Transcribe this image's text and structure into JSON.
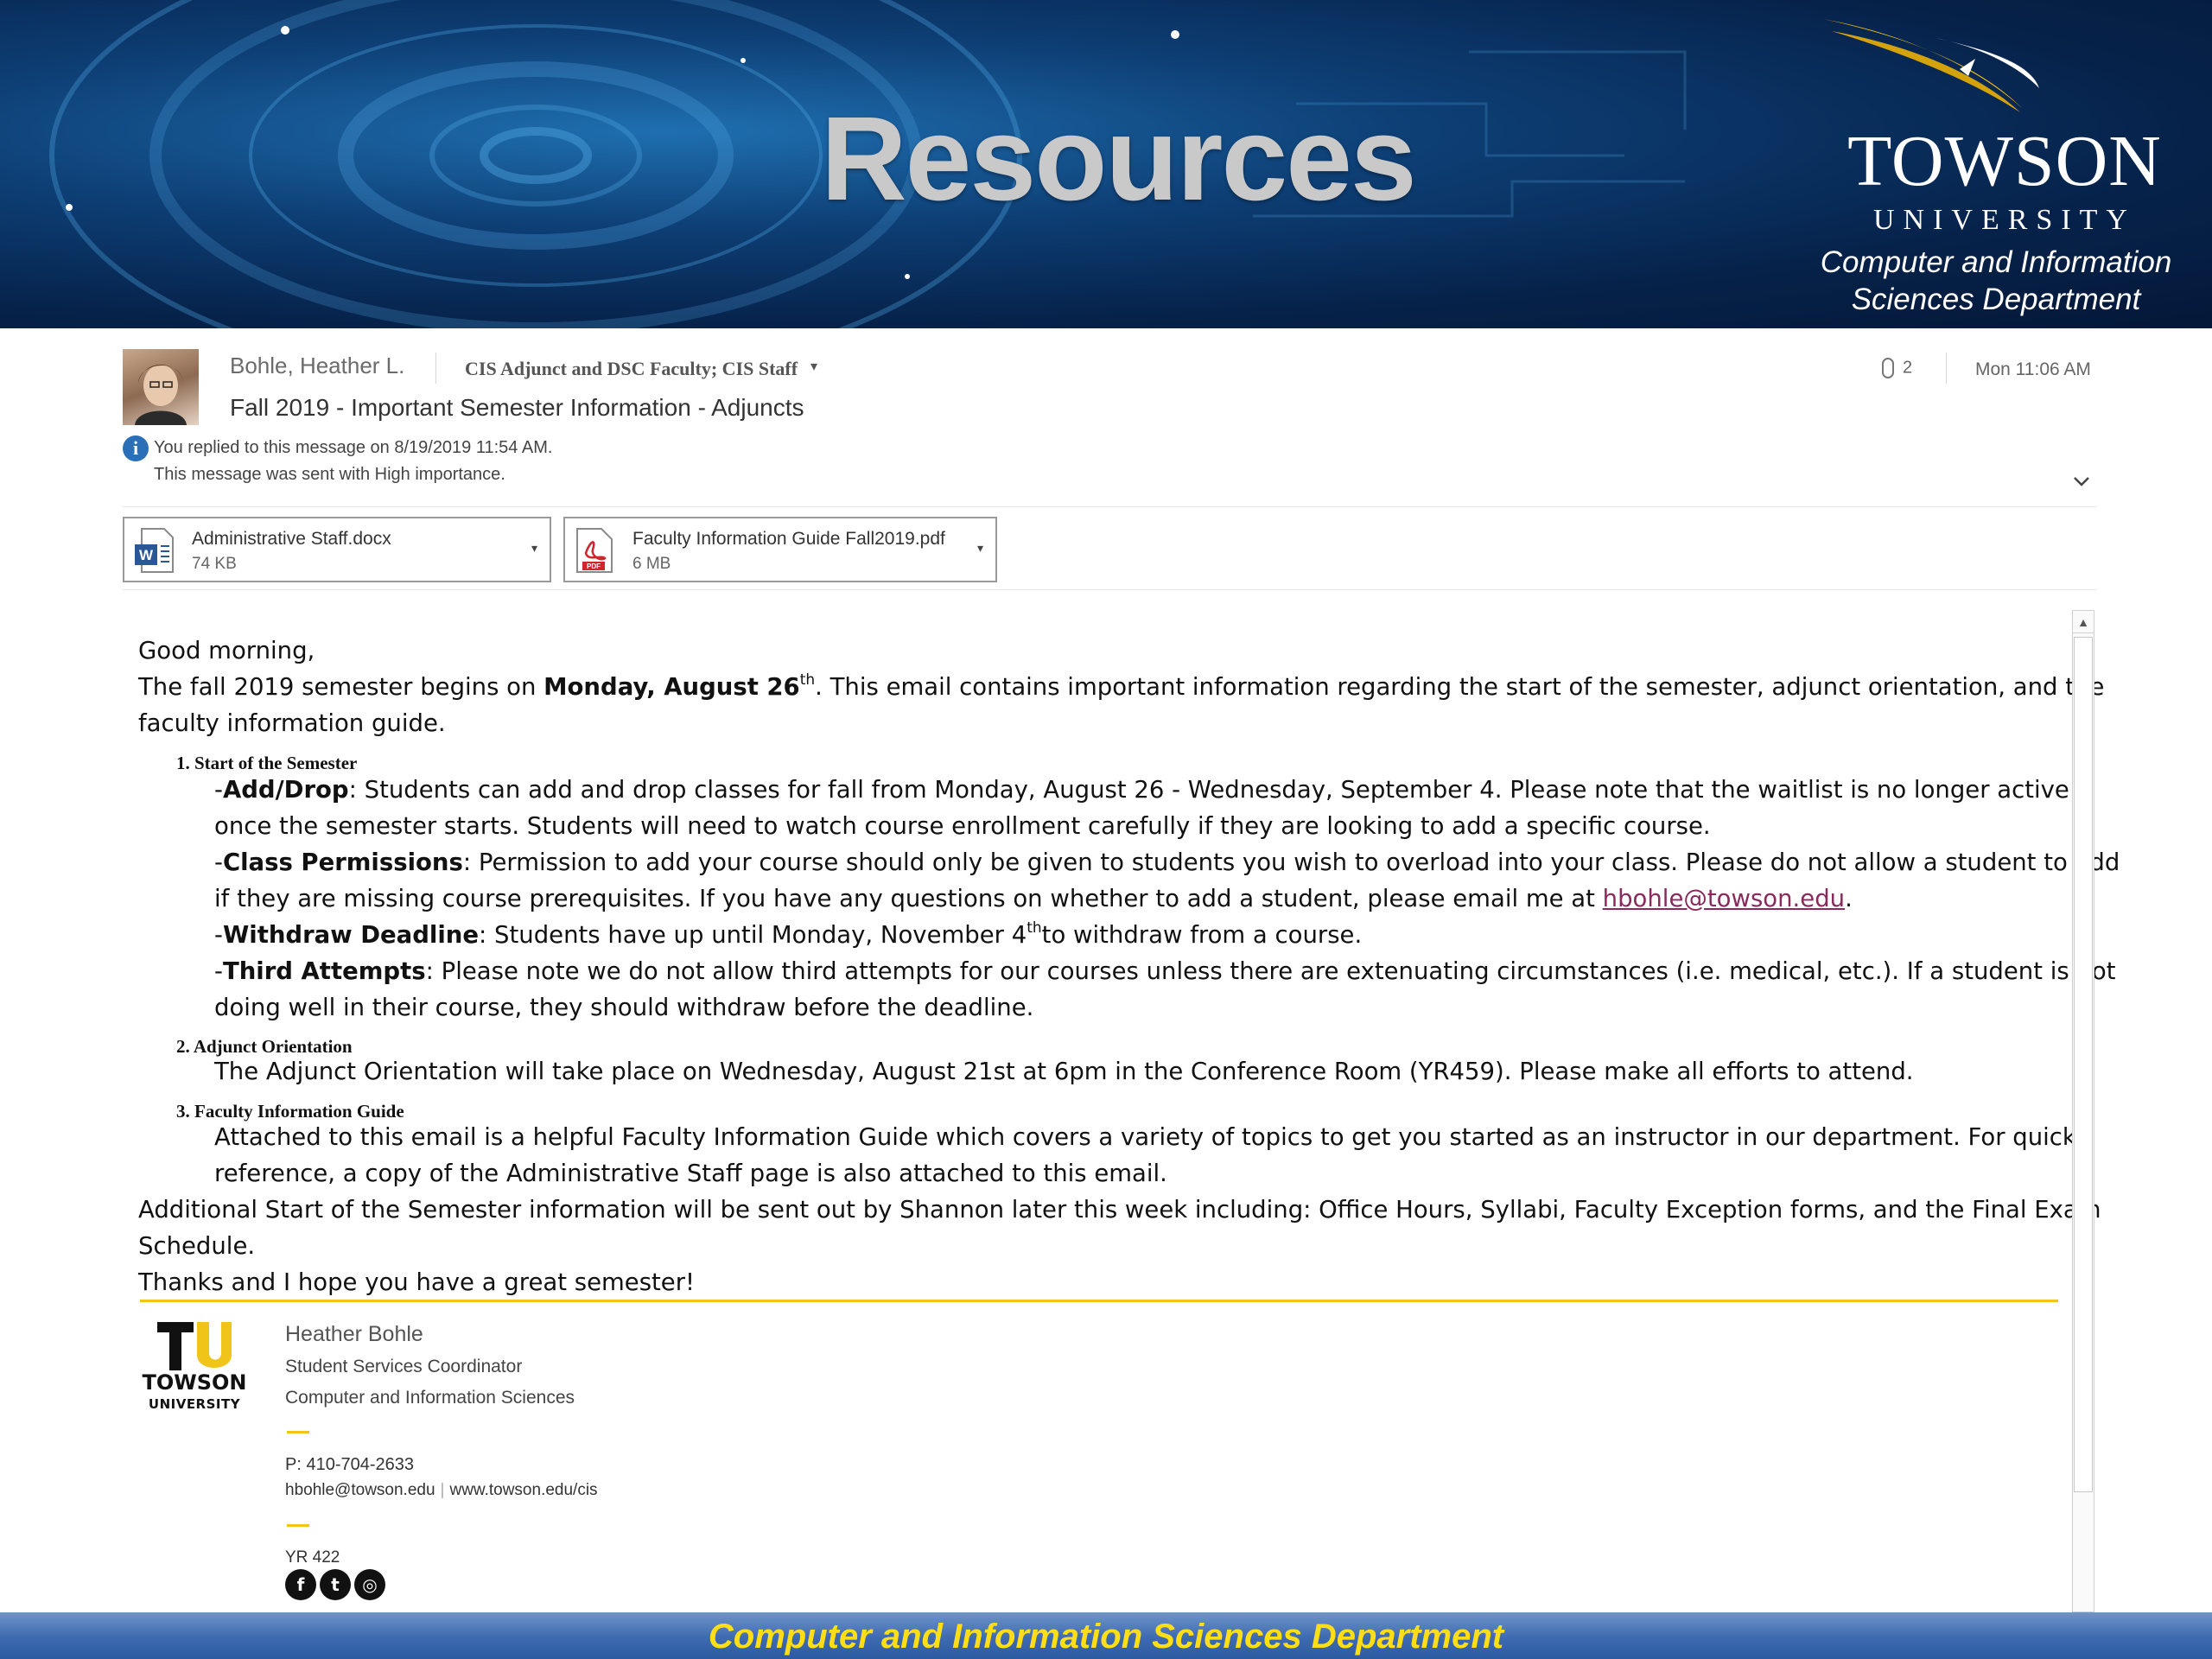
{
  "banner": {
    "title": "Resources",
    "logo_wordmark": "TOWSON",
    "logo_subtitle": "UNIVERSITY",
    "department": [
      "Computer and Information",
      "Sciences Department"
    ]
  },
  "email": {
    "sender": "Bohle, Heather L.",
    "recipients": "CIS Adjunct and DSC Faculty; CIS Staff",
    "attachment_count": "2",
    "timestamp": "Mon 11:06 AM",
    "subject": "Fall 2019 - Important Semester Information - Adjuncts",
    "info_lines": [
      "You replied to this message on 8/19/2019 11:54 AM.",
      "This message was sent with High importance."
    ],
    "attachments": [
      {
        "name": "Administrative Staff.docx",
        "size": "74 KB",
        "type_icon": "word-doc-icon"
      },
      {
        "name": "Faculty Information Guide Fall2019.pdf",
        "size": "6 MB",
        "type_icon": "pdf-icon"
      }
    ]
  },
  "body": {
    "greeting": "Good morning,",
    "intro": {
      "pre": "The fall 2019 semester begins on ",
      "bold": "Monday, August 26",
      "sup": "th",
      "post": ". This email contains important information regarding the start of the semester, adjunct orientation, and the",
      "line2": "faculty information guide."
    },
    "sections": [
      {
        "heading": "1. Start of the Semester",
        "items": [
          {
            "label": "Add/Drop",
            "lines": [
              ": Students can add and drop classes for fall from Monday, August 26 - Wednesday, September 4. Please note that the waitlist is no longer active",
              "once the semester starts. Students will need to watch course enrollment carefully if they are looking to add a specific course."
            ]
          },
          {
            "label": "Class Permissions",
            "lines": [
              ": Permission to add your course should only be given to students you wish to overload into your class. Please do not allow a student to add",
              "if they are missing course prerequisites. If you have any questions on whether to add a student, please email me at "
            ],
            "email": "hbohle@towson.edu"
          },
          {
            "label": "Withdraw Deadline",
            "pre": ": Students have up until Monday, November 4",
            "sup": "th",
            "post": "to withdraw from a course."
          },
          {
            "label": "Third Attempts",
            "lines": [
              ": Please note we do not allow third attempts for our courses unless there are extenuating circumstances (i.e. medical, etc.). If a student is not",
              "doing well in their course, they should withdraw before the deadline."
            ]
          }
        ]
      },
      {
        "heading": "2. Adjunct Orientation",
        "lines": [
          "The Adjunct Orientation will take place on Wednesday, August 21st at 6pm in the Conference Room (YR459). Please make all efforts to attend."
        ]
      },
      {
        "heading": "3. Faculty Information Guide",
        "lines": [
          "Attached to this email is a helpful Faculty Information Guide which covers a variety of topics to get you started as an instructor in our department. For quick",
          "reference, a copy of the Administrative Staff page is also attached to this email."
        ]
      }
    ],
    "additional": [
      "Additional Start of the Semester information will be sent out by Shannon later this week including: Office Hours, Syllabi, Faculty Exception forms, and the Final Exam",
      "Schedule."
    ],
    "closing": "Thanks and I hope you have a great semester!"
  },
  "signature": {
    "logo_text": "TU",
    "logo_towson": "TOWSON",
    "logo_university": "UNIVERSITY",
    "name": "Heather Bohle",
    "title": "Student Services Coordinator",
    "department": "Computer and Information Sciences",
    "phone": "P: 410-704-2633",
    "email": "hbohle@towson.edu",
    "website": "www.towson.edu/cis",
    "room": "YR 422",
    "social": [
      "facebook-icon",
      "twitter-icon",
      "instagram-icon"
    ]
  },
  "footer": {
    "text": "Computer and Information Sciences Department"
  },
  "colors": {
    "accent_gold": "#f0c419",
    "footer_text": "#ffde17",
    "banner_blue": "#0d3e74",
    "link": "#8a2a5c"
  }
}
